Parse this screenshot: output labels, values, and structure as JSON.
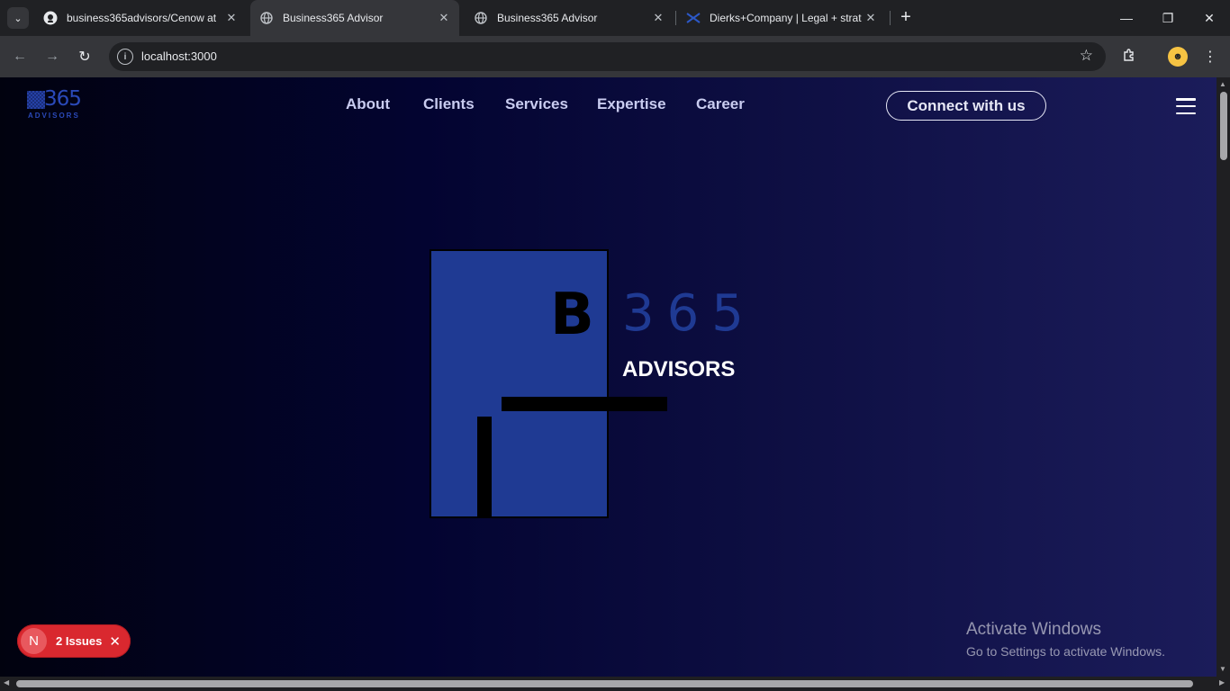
{
  "browser": {
    "tabs": [
      {
        "title": "business365advisors/Cenow at",
        "icon": "github-icon",
        "active": false
      },
      {
        "title": "Business365 Advisor",
        "icon": "globe-icon",
        "active": true
      },
      {
        "title": "Business365 Advisor",
        "icon": "globe-icon",
        "active": false
      },
      {
        "title": "Dierks+Company | Legal + strat",
        "icon": "dierks-icon",
        "active": false
      }
    ],
    "new_tab": "+",
    "address": "localhost:3000",
    "window_controls": {
      "minimize": "—",
      "restore": "❐",
      "close": "✕"
    }
  },
  "site": {
    "logo": {
      "number": "365",
      "subtitle": "ADVISORS"
    },
    "nav": [
      "About",
      "Clients",
      "Services",
      "Expertise",
      "Career"
    ],
    "cta": "Connect with us"
  },
  "hero": {
    "letter": "B",
    "number": "365",
    "subtitle": "ADVISORS"
  },
  "issues_badge": {
    "letter": "N",
    "label": "2 Issues"
  },
  "windows_watermark": {
    "line1": "Activate Windows",
    "line2": "Go to Settings to activate Windows."
  },
  "colors": {
    "accent": "#1f3a93",
    "page_dark": "#01020f",
    "page_light": "#1b1c5a",
    "issues": "#d9282f"
  }
}
